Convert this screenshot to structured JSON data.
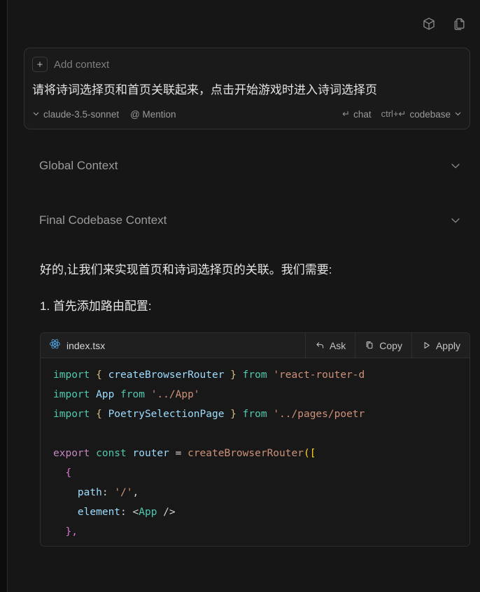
{
  "toolbar": {
    "icons": [
      {
        "name": "cube-icon",
        "title": "model-context"
      },
      {
        "name": "copy-files-icon",
        "title": "new-file"
      }
    ]
  },
  "composer": {
    "add_context_plus": "+",
    "add_context_label": "Add context",
    "message": "请将诗词选择页和首页关联起来，点击开始游戏时进入诗词选择页",
    "model": "claude-3.5-sonnet",
    "mention": "@ Mention",
    "chat_hint_key": "↵",
    "chat_hint_label": "chat",
    "codebase_hint_key": "ctrl+↵",
    "codebase_hint_label": "codebase",
    "chevron_down": "⌄"
  },
  "context_sections": [
    {
      "label": "Global Context",
      "expanded": false
    },
    {
      "label": "Final Codebase Context",
      "expanded": false
    }
  ],
  "assistant": {
    "paragraph": "好的,让我们来实现首页和诗词选择页的关联。我们需要:",
    "list_item_1": "1. 首先添加路由配置:"
  },
  "codeblock": {
    "file_icon": "react-icon",
    "file_name": "index.tsx",
    "actions": [
      {
        "name": "ask-button",
        "label": "Ask",
        "icon": "undo-arrow-icon"
      },
      {
        "name": "copy-button",
        "label": "Copy",
        "icon": "clipboard-icon"
      },
      {
        "name": "apply-button",
        "label": "Apply",
        "icon": "play-triangle-icon"
      }
    ],
    "lines": [
      [
        {
          "t": "import ",
          "c": "t-kw"
        },
        {
          "t": "{ ",
          "c": "t-brace"
        },
        {
          "t": "createBrowserRouter",
          "c": "t-id"
        },
        {
          "t": " }",
          "c": "t-brace"
        },
        {
          "t": " from ",
          "c": "t-kw"
        },
        {
          "t": "'react-router-d",
          "c": "t-str"
        }
      ],
      [
        {
          "t": "import ",
          "c": "t-kw"
        },
        {
          "t": "App",
          "c": "t-id"
        },
        {
          "t": " from ",
          "c": "t-kw"
        },
        {
          "t": "'../App'",
          "c": "t-str"
        }
      ],
      [
        {
          "t": "import ",
          "c": "t-kw"
        },
        {
          "t": "{ ",
          "c": "t-brace"
        },
        {
          "t": "PoetrySelectionPage",
          "c": "t-id"
        },
        {
          "t": " }",
          "c": "t-brace"
        },
        {
          "t": " from ",
          "c": "t-kw"
        },
        {
          "t": "'../pages/poetr",
          "c": "t-str"
        }
      ],
      [],
      [
        {
          "t": "export ",
          "c": "t-kw2"
        },
        {
          "t": "const ",
          "c": "t-kw"
        },
        {
          "t": "router",
          "c": "t-id"
        },
        {
          "t": " = ",
          "c": "t-plain"
        },
        {
          "t": "createBrowserRouter",
          "c": "t-str"
        },
        {
          "t": "([",
          "c": "t-paren"
        }
      ],
      [
        {
          "t": "  {",
          "c": "t-paren2"
        }
      ],
      [
        {
          "t": "    path",
          "c": "t-prop"
        },
        {
          "t": ": ",
          "c": "t-plain"
        },
        {
          "t": "'/'",
          "c": "t-str"
        },
        {
          "t": ",",
          "c": "t-plain"
        }
      ],
      [
        {
          "t": "    element",
          "c": "t-prop"
        },
        {
          "t": ": ",
          "c": "t-plain"
        },
        {
          "t": "<",
          "c": "t-plain"
        },
        {
          "t": "App",
          "c": "t-comp"
        },
        {
          "t": " />",
          "c": "t-plain"
        }
      ],
      [
        {
          "t": "  },",
          "c": "t-paren2"
        }
      ]
    ]
  }
}
